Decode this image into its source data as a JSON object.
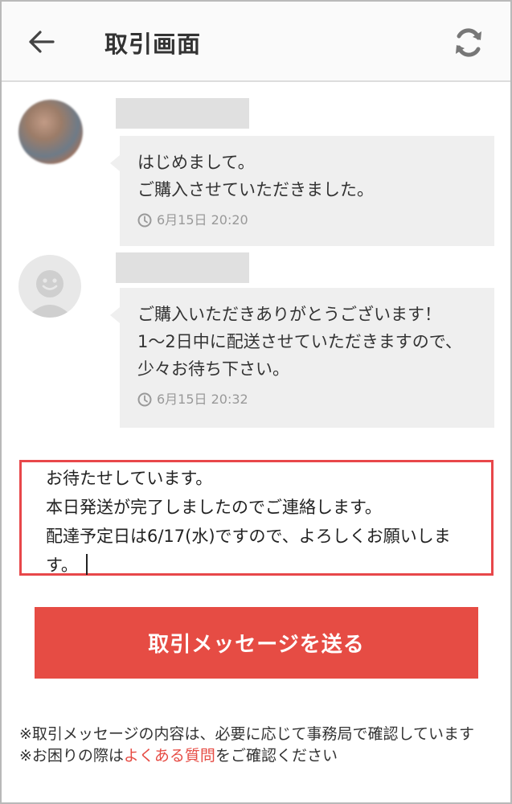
{
  "header": {
    "title": "取引画面",
    "back_icon": "arrow-left-icon",
    "refresh_icon": "refresh-icon"
  },
  "messages": [
    {
      "avatar": "photo",
      "text": "はじめまして。\nご購入させていただきました。",
      "time": "6月15日 20:20"
    },
    {
      "avatar": "default-user",
      "text": "ご購入いただきありがとうございます！\n1〜2日中に配送させていただきますので、少々お待ち下さい。",
      "time": "6月15日 20:32"
    }
  ],
  "compose": {
    "value": "お待たせしています。\n本日発送が完了しましたのでご連絡します。\n配達予定日は6/17(水)ですので、よろしくお願いします。"
  },
  "send_button": {
    "label": "取引メッセージを送る"
  },
  "notes": {
    "line1": "※取引メッセージの内容は、必要に応じて事務局で確認しています",
    "line2_prefix": "※お困りの際は",
    "line2_link": "よくある質問",
    "line2_suffix": "をご確認ください"
  },
  "colors": {
    "accent": "#e64c44",
    "compose_border": "#e8474a",
    "bubble_bg": "#efefef",
    "header_bg": "#fafafa"
  }
}
